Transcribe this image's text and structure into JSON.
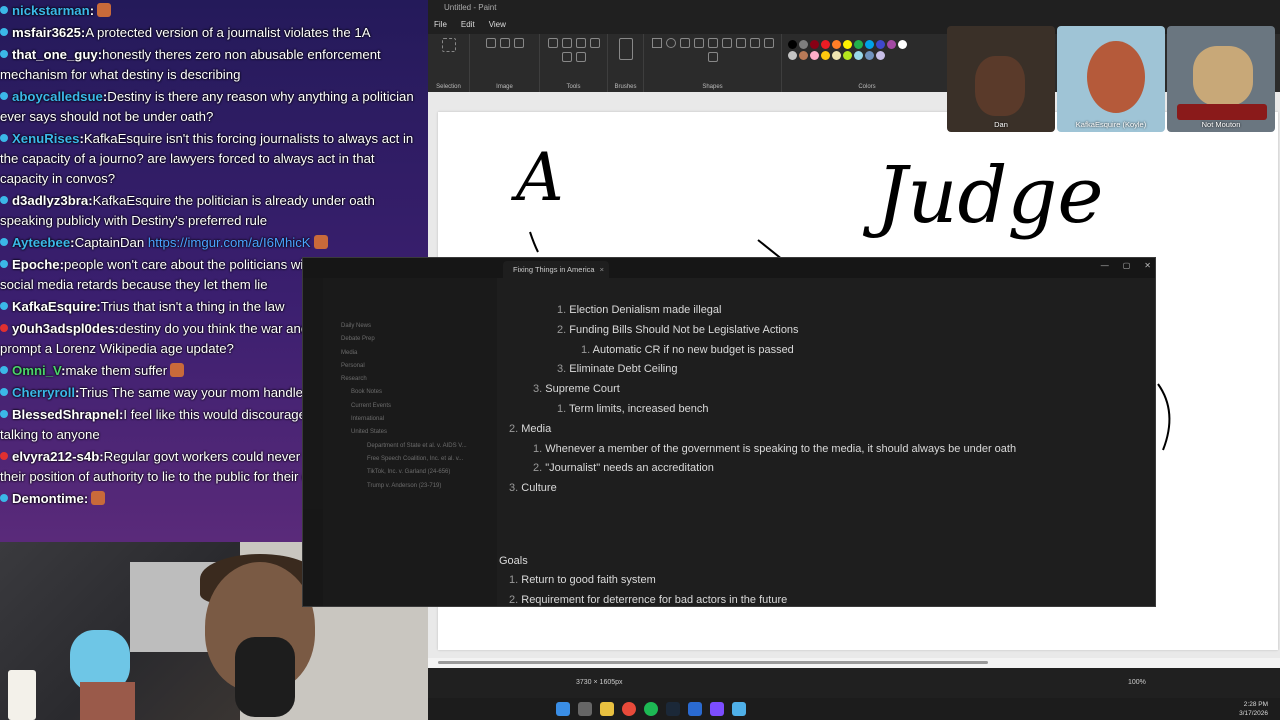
{
  "chat": {
    "messages": [
      {
        "user": "nickstarman",
        "text": "",
        "dot": "blue"
      },
      {
        "user": "msfair3625",
        "text": "A protected version of a journalist violates the 1A",
        "dot": "blue"
      },
      {
        "user": "that_one_guy",
        "text": "honestly theres zero non abusable enforcement mechanism for what destiny is describing",
        "dot": "blue"
      },
      {
        "user": "aboycalledsue",
        "text": "Destiny is there any reason why anything a politician ever says should not be under oath?",
        "dot": "blue"
      },
      {
        "user": "XenuRises",
        "text": "KafkaEsquire isn't this forcing journalists to always act in the capacity of a journo? are lawyers forced to always act in that capacity in convos?",
        "dot": "blue"
      },
      {
        "user": "d3adlyz3bra",
        "text": "KafkaEsquire the politician is already under oath speaking publicly with Destiny's preferred rule",
        "dot": "blue"
      },
      {
        "user": "Ayteebee",
        "text": "CaptainDan",
        "link": "https://imgur.com/a/I6MhicK",
        "dot": "blue"
      },
      {
        "user": "Epoche",
        "text": "people won't care about the politicians will just go to the social media retards because they let them lie",
        "dot": "blue"
      },
      {
        "user": "KafkaEsquire",
        "text": "Trius that isn't a thing in the law",
        "dot": "blue"
      },
      {
        "user": "y0uh3adspl0des",
        "text": "destiny do you think the war and incoming draft will prompt a Lorenz Wikipedia age update?",
        "dot": "red"
      },
      {
        "user": "Omni_V",
        "text": "make them suffer",
        "dot": "blue"
      },
      {
        "user": "Cherryroll",
        "text": "Trius The same way your mom handles deeze nuts",
        "dot": "blue"
      },
      {
        "user": "BlessedShrapnel",
        "text": "I feel like this would discourage politicians not talking to anyone",
        "dot": "blue"
      },
      {
        "user": "elvyra212-s4b",
        "text": "Regular govt workers could never get away with using their position of authority to lie to the public for their own gain",
        "dot": "red"
      },
      {
        "user": "Demontime",
        "text": "",
        "dot": "blue"
      }
    ]
  },
  "paint": {
    "title": "Untitled - Paint",
    "menu": [
      "File",
      "Edit",
      "View"
    ],
    "ribbon_groups": [
      "Selection",
      "Image",
      "Tools",
      "Brushes",
      "Shapes",
      "Colors"
    ],
    "status_dims": "3730 × 1605px",
    "zoom": "100%",
    "canvas_text_left": "A",
    "canvas_text_right": "Judge",
    "swatch_colors": [
      "#000000",
      "#7f7f7f",
      "#880015",
      "#ed1c24",
      "#ff7f27",
      "#fff200",
      "#22b14c",
      "#00a2e8",
      "#3f48cc",
      "#a349a4",
      "#ffffff",
      "#c3c3c3",
      "#b97a57",
      "#ffaec9",
      "#ffc90e",
      "#efe4b0",
      "#b5e61d",
      "#99d9ea",
      "#7092be",
      "#c8bfe7"
    ]
  },
  "call_tiles": [
    {
      "name": "Dan"
    },
    {
      "name": "KafkaEsquire (Koyle)"
    },
    {
      "name": "Not Mouton"
    }
  ],
  "obsidian": {
    "tab_title": "Fixing Things in America",
    "sidebar_tree": [
      "Daily News",
      "Debate Prep",
      "Media",
      "Personal",
      "Research",
      "Book Notes",
      "Current Events",
      "International",
      "United States",
      "Department of State et al. v. AIDS V...",
      "Free Speech Coalition, Inc. et al. v...",
      "TikTok, Inc. v. Garland (24-656)",
      "Trump v. Anderson (23-719)"
    ],
    "lines": [
      {
        "num": "1.",
        "text": "Election Denialism made illegal",
        "indent": 2
      },
      {
        "num": "2.",
        "text": "Funding Bills Should Not be Legislative Actions",
        "indent": 2
      },
      {
        "num": "1.",
        "text": "Automatic CR if no new budget is passed",
        "indent": 3
      },
      {
        "num": "3.",
        "text": "Eliminate Debt Ceiling",
        "indent": 2
      },
      {
        "num": "3.",
        "text": "Supreme Court",
        "indent": 1
      },
      {
        "num": "1.",
        "text": "Term limits, increased bench",
        "indent": 2
      },
      {
        "num": "2.",
        "text": "Media",
        "indent": 0
      },
      {
        "num": "1.",
        "text": "Whenever a member of the government is speaking to the media, it should always be under oath",
        "indent": 1
      },
      {
        "num": "2.",
        "text": "\"Journalist\" needs an accreditation",
        "indent": 1
      },
      {
        "num": "3.",
        "text": "Culture",
        "indent": 0
      }
    ],
    "goals_heading": "Goals",
    "goals": [
      {
        "num": "1.",
        "text": "Return to good faith system"
      },
      {
        "num": "2.",
        "text": "Requirement for deterrence for bad actors in the future"
      }
    ]
  },
  "taskbar": {
    "time": "2:28 PM",
    "date": "3/17/2026"
  }
}
